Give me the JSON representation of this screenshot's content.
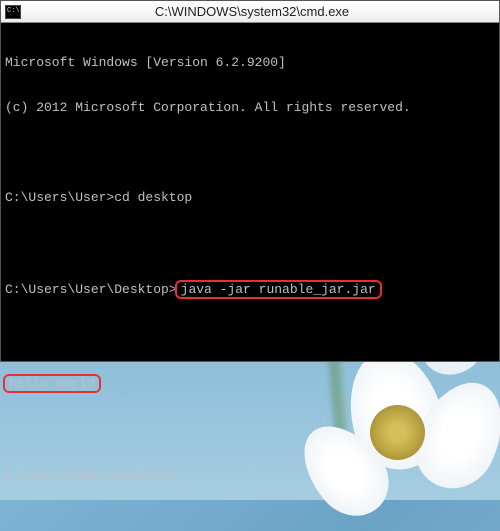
{
  "window": {
    "title": "C:\\WINDOWS\\system32\\cmd.exe",
    "icon_name": "cmd-icon"
  },
  "terminal": {
    "header_line1": "Microsoft Windows [Version 6.2.9200]",
    "header_line2": "(c) 2012 Microsoft Corporation. All rights reserved.",
    "lines": [
      {
        "prompt": "C:\\Users\\User>",
        "command": "cd desktop",
        "highlighted": false
      },
      {
        "prompt": "C:\\Users\\User\\Desktop>",
        "command": "java -jar runable_jar.jar",
        "highlighted": true
      }
    ],
    "output": "hello world",
    "output_highlighted": true,
    "current_prompt": "C:\\Users\\User\\Desktop>",
    "cursor": "_"
  },
  "colors": {
    "terminal_bg": "#000000",
    "terminal_fg": "#c0c0c0",
    "highlight_border": "#e83030",
    "titlebar_bg": "#f0f0f0"
  }
}
